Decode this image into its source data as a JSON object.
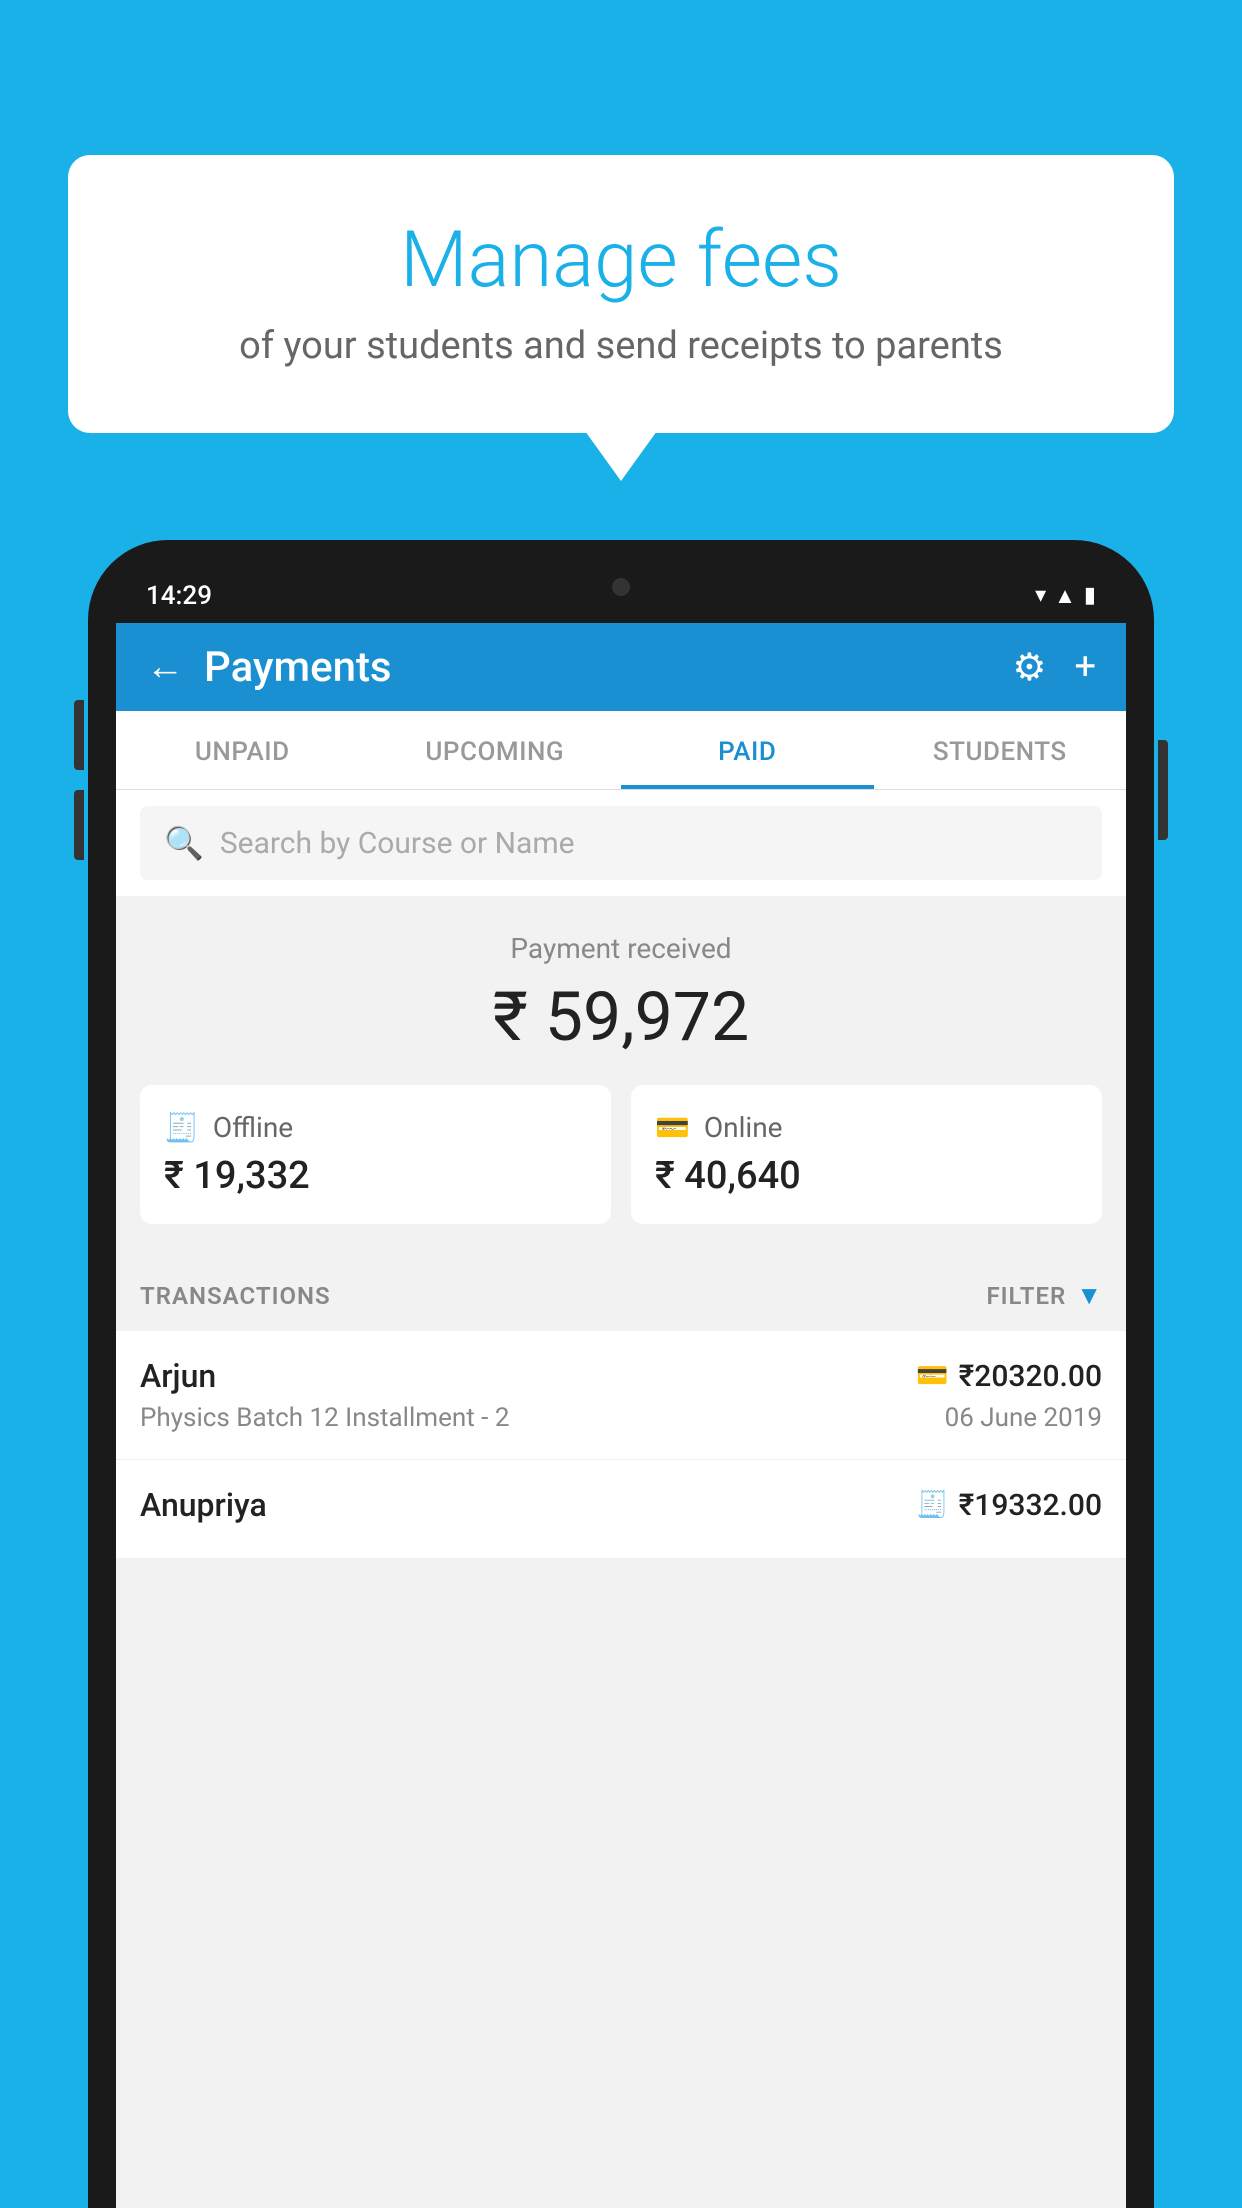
{
  "background_color": "#1ab0e8",
  "bubble": {
    "title": "Manage fees",
    "subtitle": "of your students and send receipts to parents"
  },
  "phone": {
    "time": "14:29",
    "header": {
      "title": "Payments",
      "back_label": "←",
      "gear_label": "⚙",
      "plus_label": "+"
    },
    "tabs": [
      {
        "label": "UNPAID",
        "active": false
      },
      {
        "label": "UPCOMING",
        "active": false
      },
      {
        "label": "PAID",
        "active": true
      },
      {
        "label": "STUDENTS",
        "active": false
      }
    ],
    "search": {
      "placeholder": "Search by Course or Name"
    },
    "payment_summary": {
      "received_label": "Payment received",
      "amount": "₹ 59,972",
      "offline_label": "Offline",
      "offline_amount": "₹ 19,332",
      "online_label": "Online",
      "online_amount": "₹ 40,640"
    },
    "transactions_section": {
      "label": "TRANSACTIONS",
      "filter_label": "FILTER"
    },
    "transactions": [
      {
        "name": "Arjun",
        "amount": "₹20320.00",
        "description": "Physics Batch 12 Installment - 2",
        "date": "06 June 2019",
        "icon": "card"
      },
      {
        "name": "Anupriya",
        "amount": "₹19332.00",
        "description": "",
        "date": "",
        "icon": "cash"
      }
    ]
  }
}
